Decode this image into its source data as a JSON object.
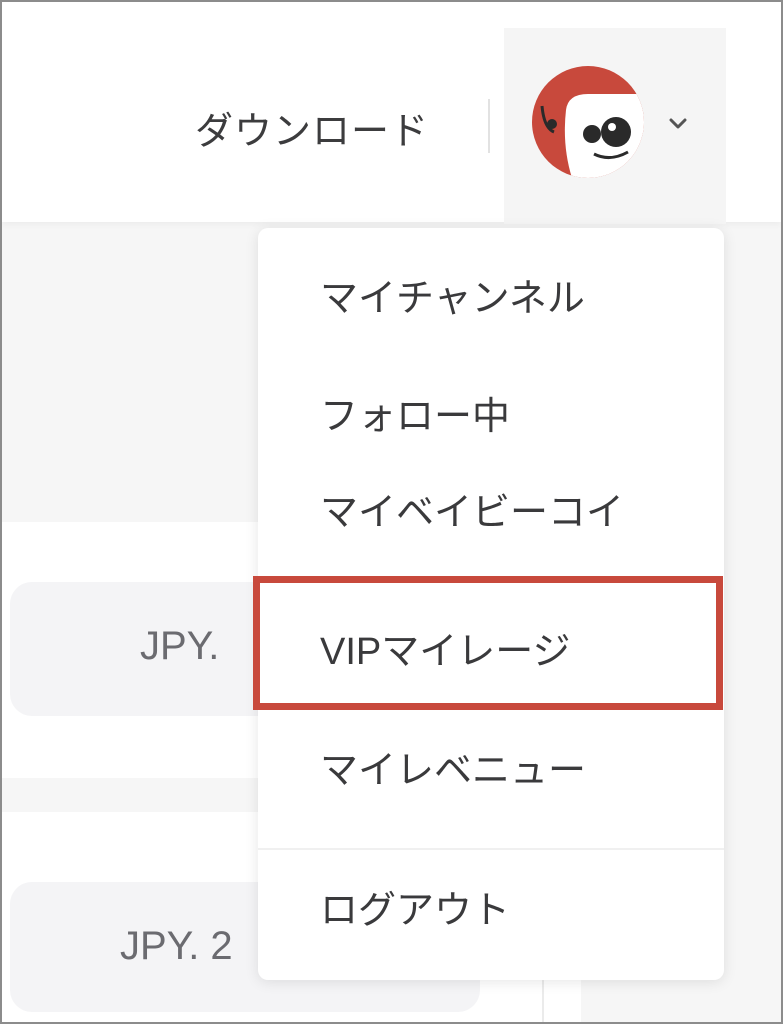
{
  "header": {
    "download_label": "ダウンロード",
    "avatar_icon": "user-avatar-icon",
    "dropdown_icon": "chevron-down-icon"
  },
  "dropdown_menu": {
    "items": [
      {
        "label": "マイチャンネル"
      },
      {
        "label": "フォロー中"
      },
      {
        "label": "マイベイビーコイン"
      },
      {
        "label": "VIPマイレージ"
      },
      {
        "label": "マイレベニュー"
      },
      {
        "label": "ログアウト"
      }
    ],
    "highlighted_item": "VIPマイレージ"
  },
  "background": {
    "price_1": "JPY.",
    "price_2": "JPY. 2"
  },
  "colors": {
    "highlight": "#c8493c",
    "avatar": "#c8493c"
  }
}
